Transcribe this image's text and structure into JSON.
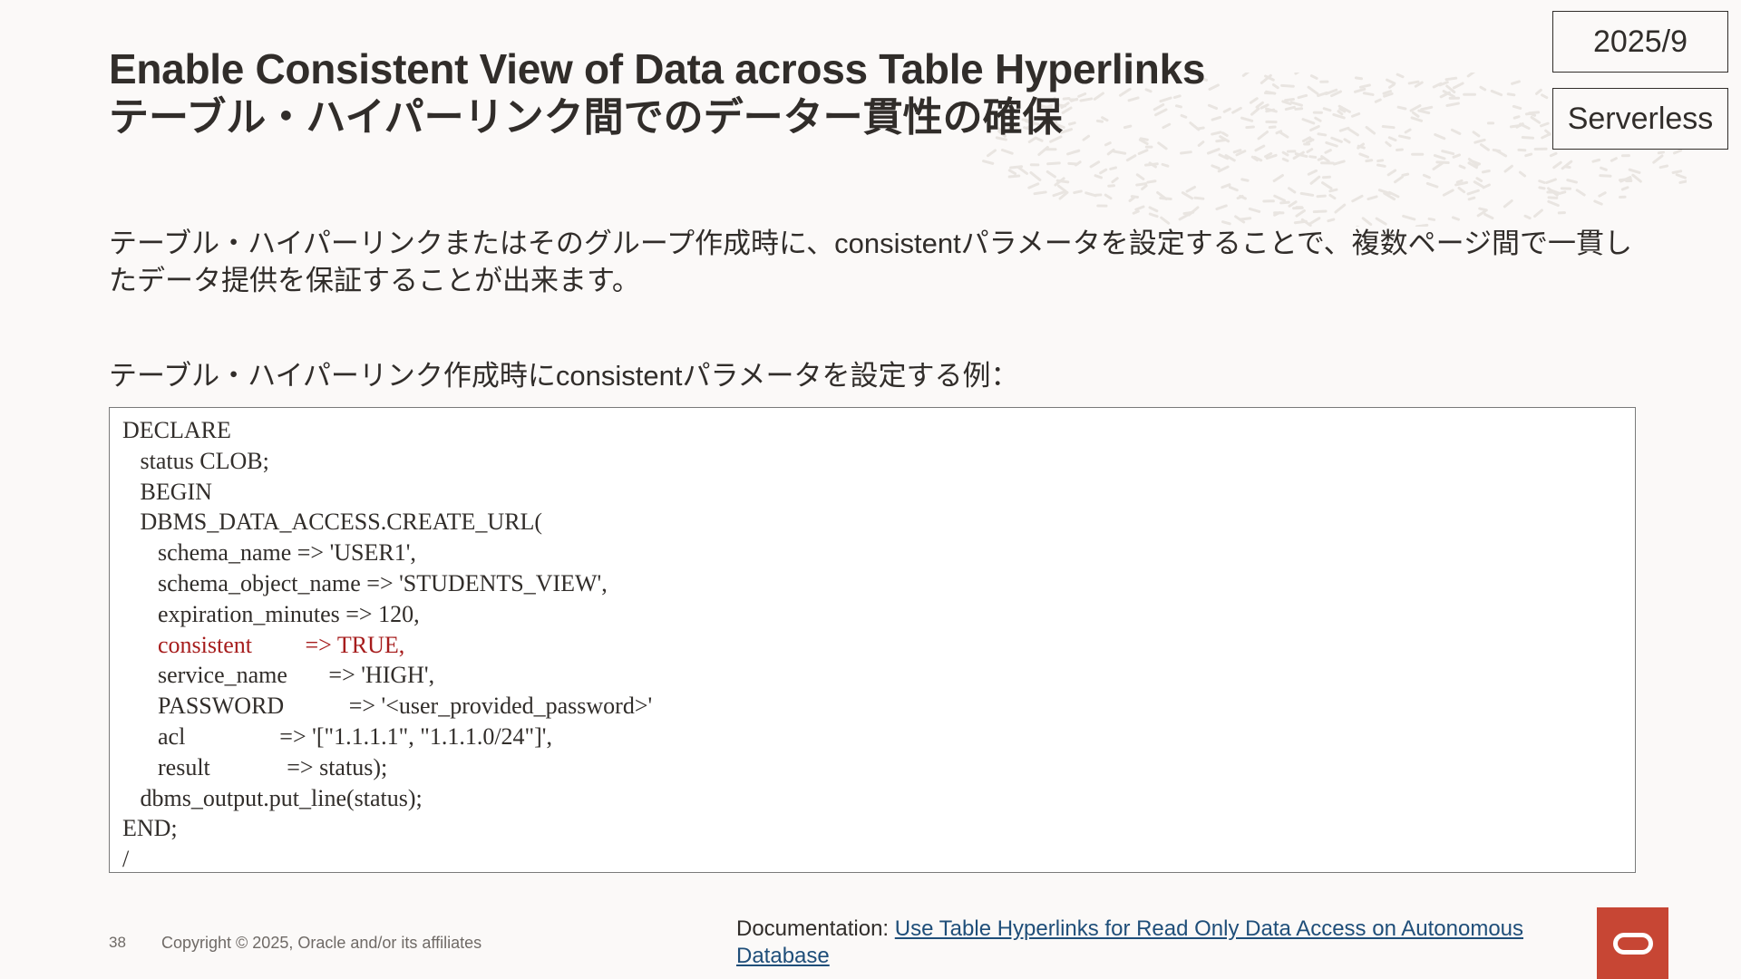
{
  "slide": {
    "title_en": "Enable Consistent View of Data across Table Hyperlinks",
    "title_ja": "テーブル・ハイパーリンク間でのデーター貫性の確保",
    "tag_date": "2025/9",
    "tag_env": "Serverless",
    "description": "テーブル・ハイパーリンクまたはそのグループ作成時に、consistentパラメータを設定することで、複数ページ間で一貫したデータ提供を保証することが出来ます。",
    "example_label": "テーブル・ハイパーリンク作成時にconsistentパラメータを設定する例：",
    "code_lines": [
      "DECLARE",
      "   status CLOB;",
      "   BEGIN",
      "   DBMS_DATA_ACCESS.CREATE_URL(",
      "      schema_name => 'USER1',",
      "      schema_object_name => 'STUDENTS_VIEW',",
      "      expiration_minutes => 120,",
      "      consistent         => TRUE,",
      "      service_name       => 'HIGH',",
      "      PASSWORD           => '<user_provided_password>'",
      "      acl                => '[\"1.1.1.1\", \"1.1.1.0/24\"]',",
      "      result             => status);",
      "   dbms_output.put_line(status);",
      "END;",
      "/"
    ],
    "highlight_line_index": 7,
    "highlight_color": "#a61c1c"
  },
  "footer": {
    "page_number": "38",
    "copyright": "Copyright © 2025, Oracle and/or its affiliates",
    "doc_prefix": "Documentation: ",
    "doc_link": "Use Table Hyperlinks for Read Only Data Access on Autonomous Database",
    "logo_icon": "oracle-logo-icon",
    "logo_color": "#c74634"
  }
}
